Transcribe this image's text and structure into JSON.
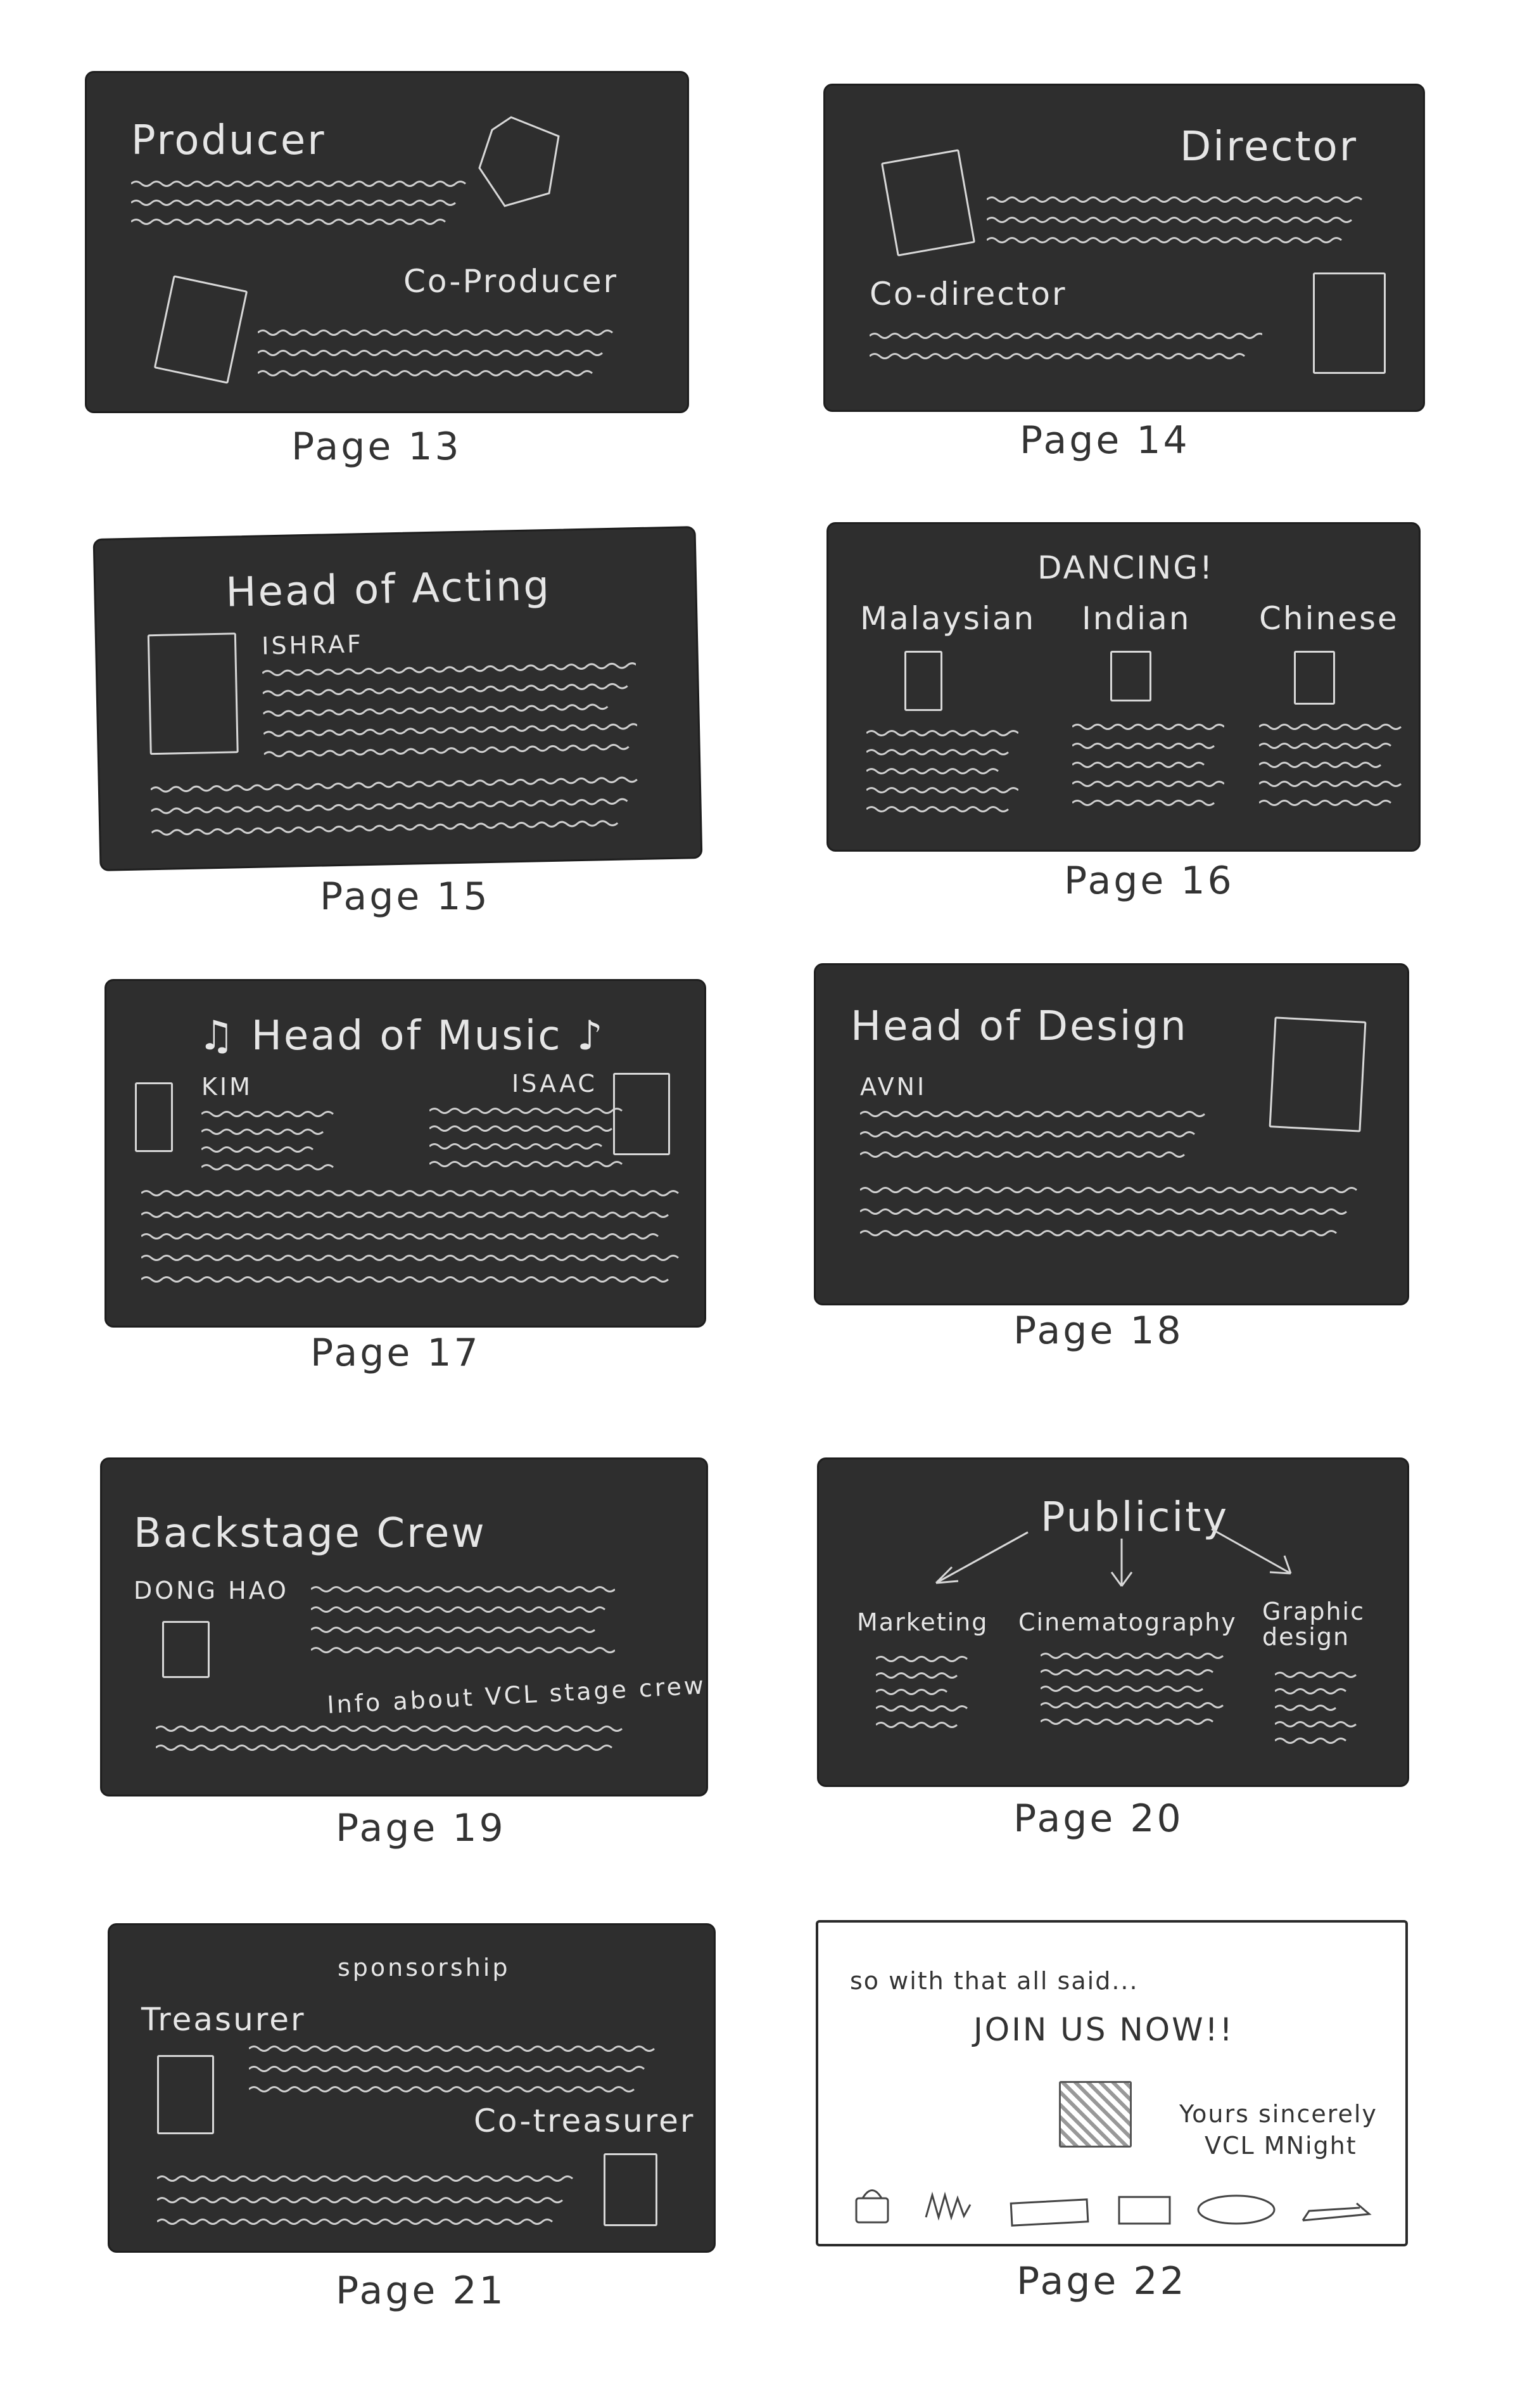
{
  "pages": [
    {
      "caption": "Page 13",
      "labels": {
        "title": "Producer",
        "sub": "Co-Producer"
      }
    },
    {
      "caption": "Page 14",
      "labels": {
        "title": "Director",
        "sub": "Co-director"
      }
    },
    {
      "caption": "Page 15",
      "labels": {
        "title": "Head of Acting",
        "name": "ISHRAF"
      }
    },
    {
      "caption": "Page 16",
      "labels": {
        "title": "DANCING!",
        "col1": "Malaysian",
        "col2": "Indian",
        "col3": "Chinese"
      }
    },
    {
      "caption": "Page 17",
      "labels": {
        "title": "♫ Head of Music ♪",
        "name1": "KIM",
        "name2": "ISAAC"
      }
    },
    {
      "caption": "Page 18",
      "labels": {
        "title": "Head of Design",
        "name": "AVNI"
      }
    },
    {
      "caption": "Page 19",
      "labels": {
        "title": "Backstage Crew",
        "name": "DONG HAO",
        "note": "Info about VCL stage crew"
      }
    },
    {
      "caption": "Page 20",
      "labels": {
        "title": "Publicity",
        "col1": "Marketing",
        "col2": "Cinematography",
        "col3": "Graphic design"
      }
    },
    {
      "caption": "Page 21",
      "labels": {
        "title": "sponsorship",
        "sub1": "Treasurer",
        "sub2": "Co-treasurer"
      }
    },
    {
      "caption": "Page 22",
      "labels": {
        "intro": "so with that all said...",
        "headline": "JOIN US NOW!!",
        "sign1": "Yours sincerely",
        "sign2": "VCL MNight"
      }
    }
  ],
  "colors": {
    "card": "#2e2e2e",
    "ink": "#e6e6e6",
    "caption": "#333333",
    "page": "#ffffff"
  }
}
